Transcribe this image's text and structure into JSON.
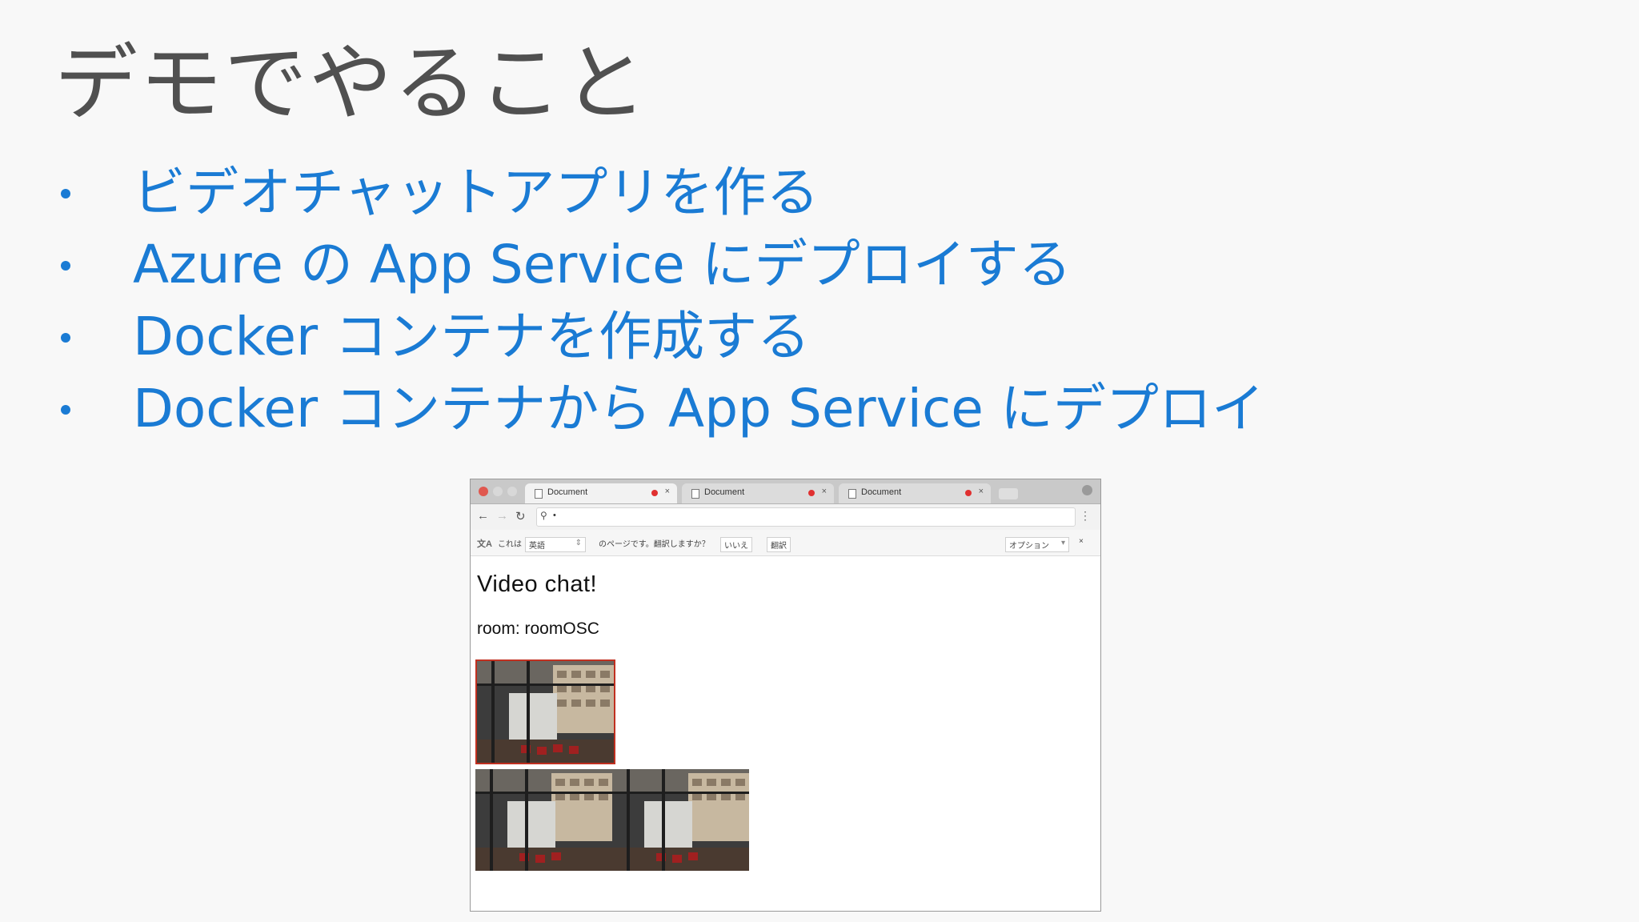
{
  "slide": {
    "title": "デモでやること",
    "bullets": [
      "ビデオチャットアプリを作る",
      "Azure の App Service にデプロイする",
      "Docker コンテナを作成する",
      "Docker コンテナから App Service にデプロイ"
    ]
  },
  "browser": {
    "tabs": [
      {
        "label": "Document"
      },
      {
        "label": "Document"
      },
      {
        "label": "Document"
      }
    ],
    "address_value": "•",
    "translate_bar": {
      "prefix": "これは",
      "language": "英語",
      "message": "のページです。翻訳しますか？",
      "no_button": "いいえ",
      "translate_button": "翻訳",
      "options": "オプション"
    },
    "page": {
      "heading": "Video chat!",
      "room": "room: roomOSC"
    }
  },
  "colors": {
    "title": "#505050",
    "bullet": "#1a7bd4",
    "background": "#f8f8f8",
    "video_border": "#c03020"
  }
}
